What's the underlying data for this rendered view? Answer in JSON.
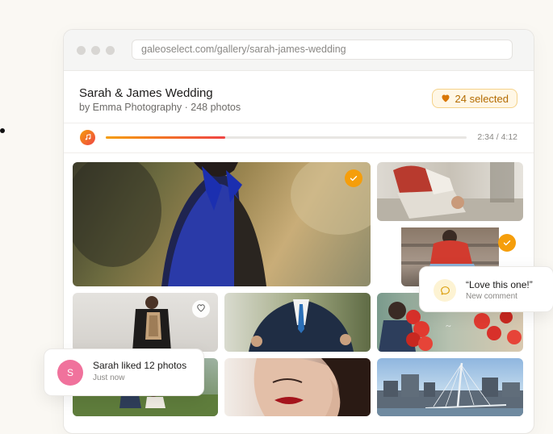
{
  "browser": {
    "url": "galeoselect.com/gallery/sarah-james-wedding"
  },
  "gallery": {
    "title": "Sarah & James Wedding",
    "subtitle": "by Emma Photography · 248 photos",
    "selected_badge": "24 selected"
  },
  "player": {
    "time": "2:34 / 4:12",
    "progress_fraction": 0.33
  },
  "photos": [
    {
      "subject": "woman-blue-dress-bow",
      "selected": true
    },
    {
      "subject": "man-sitting-red-vest",
      "selected": false
    },
    {
      "subject": "woman-red-top-steps",
      "selected": true
    },
    {
      "subject": "woman-posing-studio",
      "selected": false,
      "favoritable": true
    },
    {
      "subject": "man-suit-tie",
      "selected": false
    },
    {
      "subject": "couple-red-balloons",
      "selected": false
    },
    {
      "subject": "couple-on-grass",
      "selected": false
    },
    {
      "subject": "woman-red-lips-closeup",
      "selected": false
    },
    {
      "subject": "city-bridge-skyline",
      "selected": false
    }
  ],
  "comment_toast": {
    "quote": "“Love this one!”",
    "label": "New comment"
  },
  "like_toast": {
    "avatar_letter": "S",
    "message": "Sarah liked 12 photos",
    "time": "Just now"
  },
  "colors": {
    "accent": "#f59e0b",
    "accent_red": "#ef4444",
    "avatar": "#f0729c"
  }
}
